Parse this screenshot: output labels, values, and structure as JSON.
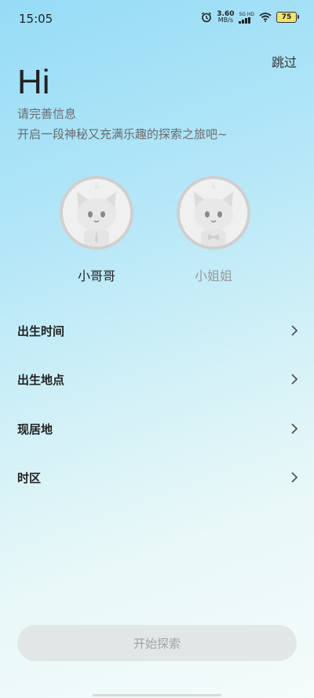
{
  "status_bar": {
    "time": "15:05",
    "net_speed_value": "3.60",
    "net_speed_unit": "MB/s",
    "network_label": "5G HD",
    "battery": "75"
  },
  "header": {
    "skip_label": "跳过",
    "greeting": "Hi",
    "subtitle_1": "请完善信息",
    "subtitle_2": "开启一段神秘又充满乐趣的探索之旅吧~"
  },
  "gender": {
    "male_label": "小哥哥",
    "female_label": "小姐姐"
  },
  "form": {
    "rows": [
      {
        "label": "出生时间"
      },
      {
        "label": "出生地点"
      },
      {
        "label": "现居地"
      },
      {
        "label": "时区"
      }
    ]
  },
  "start_button": {
    "label": "开始探索"
  }
}
